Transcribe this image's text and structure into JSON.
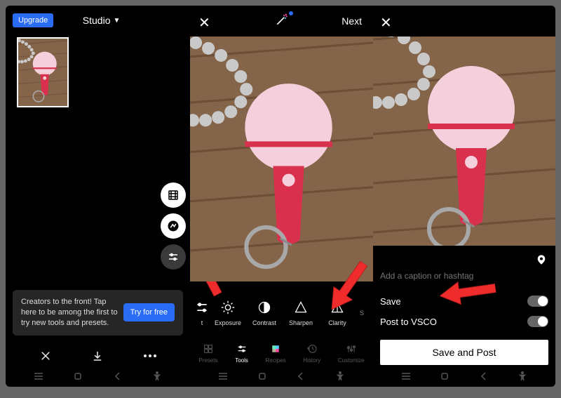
{
  "pane1": {
    "upgrade_label": "Upgrade",
    "studio_label": "Studio",
    "promo_text": "Creators to the front! Tap here to be among the first to try new tools and presets.",
    "try_free_label": "Try for free"
  },
  "pane2": {
    "next_label": "Next",
    "tools": [
      {
        "label": "Exposure"
      },
      {
        "label": "Contrast"
      },
      {
        "label": "Sharpen"
      },
      {
        "label": "Clarity"
      }
    ],
    "tabs": {
      "presets": "Presets",
      "tools": "Tools",
      "recipes": "Recipes",
      "history": "History",
      "customize": "Customize"
    }
  },
  "pane3": {
    "caption_placeholder": "Add a caption or hashtag",
    "save_label": "Save",
    "post_vsco_label": "Post to VSCO",
    "save_post_label": "Save and Post"
  }
}
